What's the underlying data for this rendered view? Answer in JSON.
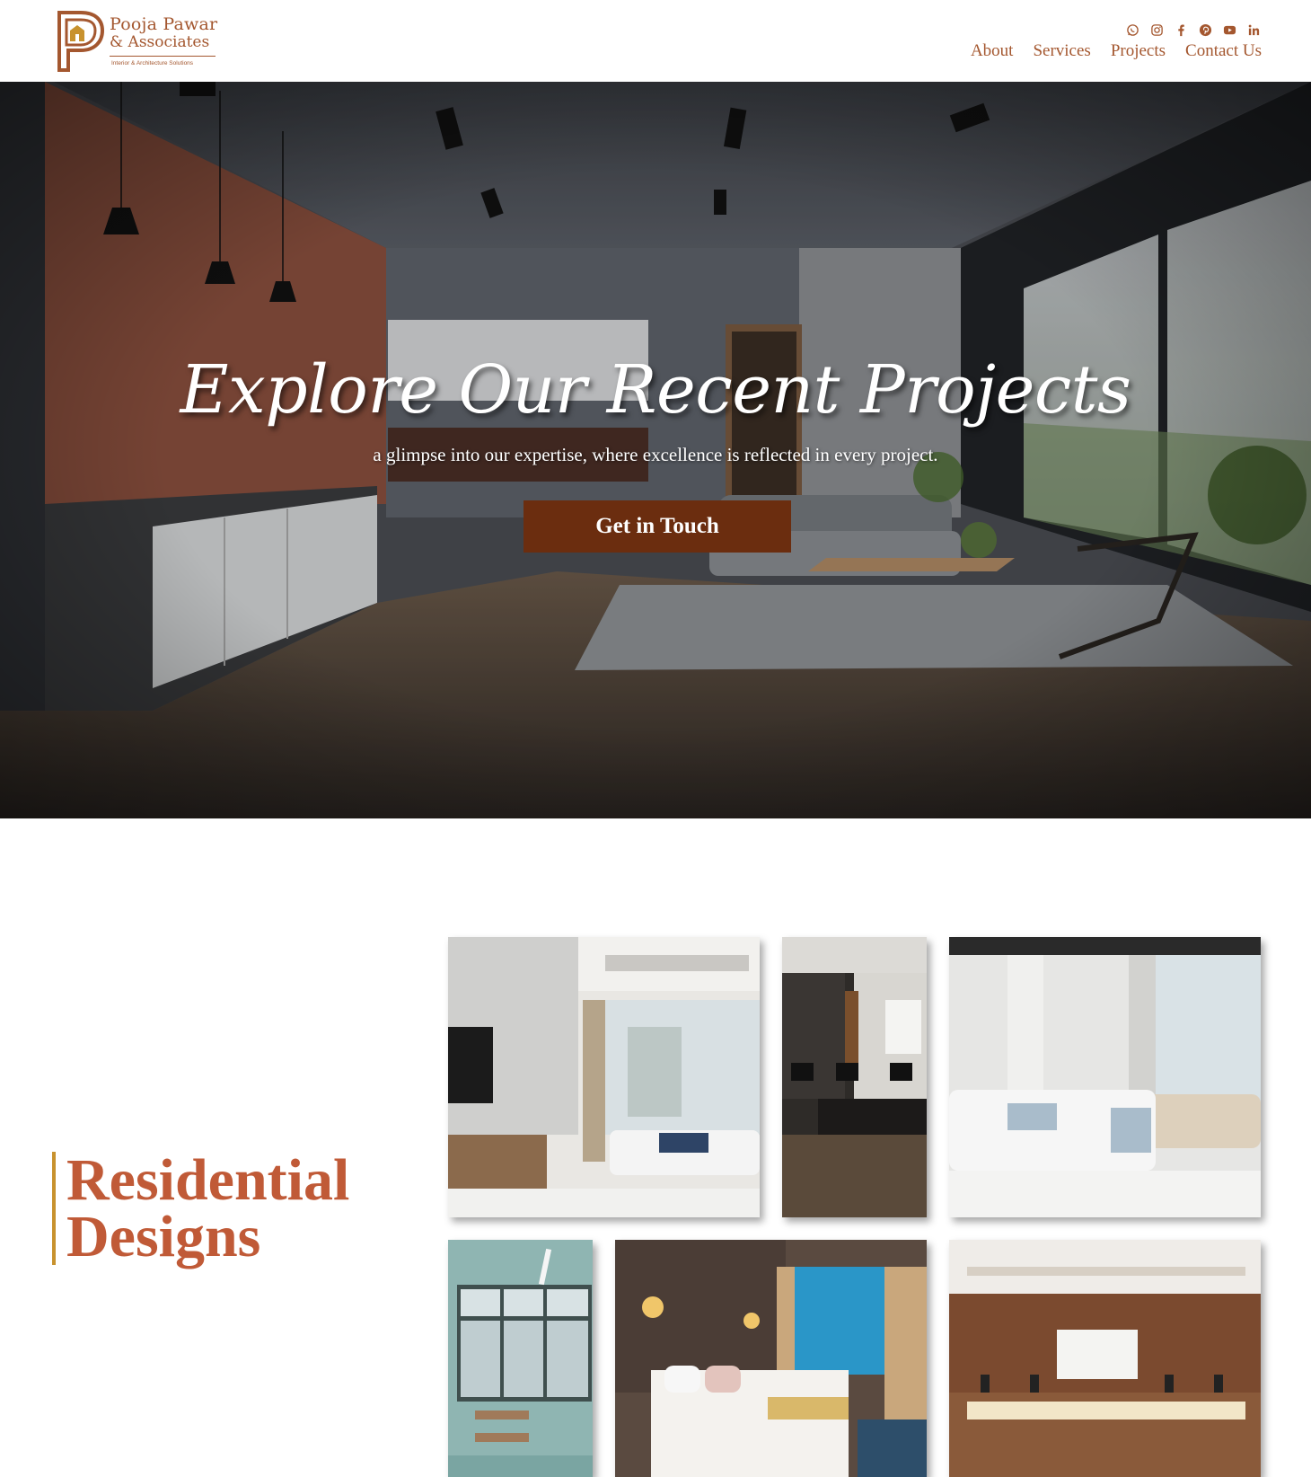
{
  "brand": {
    "name_line1": "Pooja Pawar",
    "name_line2": "& Associates",
    "tagline": "Interior & Architecture Solutions",
    "color": "#a4572f"
  },
  "social_icons": [
    "whatsapp-icon",
    "instagram-icon",
    "facebook-icon",
    "pinterest-icon",
    "youtube-icon",
    "linkedin-icon"
  ],
  "nav": {
    "items": [
      "About",
      "Services",
      "Projects",
      "Contact Us"
    ]
  },
  "hero": {
    "title": "Explore Our Recent Projects",
    "subtitle": "a glimpse into our expertise, where excellence is reflected in every project.",
    "cta_label": "Get in Touch",
    "cta_color": "#6b2d0f"
  },
  "section": {
    "title_line1": "Residential",
    "title_line2": "Designs",
    "title_color": "#c05a37",
    "accent_color": "#c8922e"
  }
}
